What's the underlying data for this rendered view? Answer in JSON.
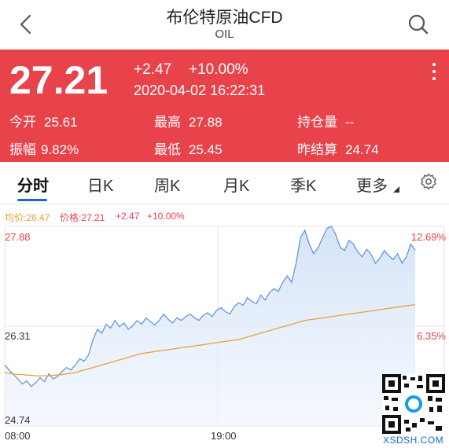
{
  "nav": {
    "title": "布伦特原油CFD",
    "subtitle": "OIL",
    "back_icon": "chevron-left-icon",
    "search_icon": "search-icon"
  },
  "quote": {
    "price": "27.21",
    "change": "+2.47",
    "change_pct": "+10.00%",
    "time": "2020-04-02 16:22:31",
    "color": "#e8434b",
    "stats": [
      {
        "label": "今开",
        "value": "25.61"
      },
      {
        "label": "最高",
        "value": "27.88"
      },
      {
        "label": "持仓量",
        "value": "--"
      },
      {
        "label": "振幅",
        "value": "9.82%"
      },
      {
        "label": "最低",
        "value": "25.45"
      },
      {
        "label": "昨结算",
        "value": "24.74"
      }
    ]
  },
  "tabs": [
    {
      "label": "分时",
      "active": true
    },
    {
      "label": "日K"
    },
    {
      "label": "周K"
    },
    {
      "label": "月K"
    },
    {
      "label": "季K"
    },
    {
      "label": "更多"
    }
  ],
  "accent": "#1a67d8",
  "info": {
    "avg_label": "均价:26.47",
    "price_label": "价格:27.21",
    "change": "+2.47",
    "change_pct": "+10.00%",
    "avg_color": "#e8a13a"
  },
  "chart_data": {
    "type": "line",
    "x_ticks": [
      "08:00",
      "19:00"
    ],
    "y_left": [
      "27.88",
      "26.31",
      "24.74"
    ],
    "y_right": [
      "12.69%",
      "6.35%"
    ],
    "ylim": [
      24.74,
      27.88
    ],
    "series": [
      {
        "name": "价格",
        "color": "#5b8fd8",
        "values": [
          25.7,
          25.62,
          25.55,
          25.48,
          25.4,
          25.45,
          25.36,
          25.42,
          25.5,
          25.44,
          25.56,
          25.48,
          25.52,
          25.6,
          25.66,
          25.62,
          25.7,
          25.8,
          25.76,
          25.86,
          26.1,
          26.26,
          26.2,
          26.34,
          26.28,
          26.4,
          26.3,
          26.36,
          26.26,
          26.32,
          26.4,
          26.34,
          26.44,
          26.38,
          26.33,
          26.4,
          26.5,
          26.42,
          26.36,
          26.44,
          26.4,
          26.46,
          26.5,
          26.44,
          26.4,
          26.48,
          26.52,
          26.46,
          26.56,
          26.6,
          26.54,
          26.5,
          26.62,
          26.68,
          26.64,
          26.76,
          26.7,
          26.66,
          26.8,
          26.72,
          26.84,
          26.9,
          26.86,
          27.0,
          27.1,
          27.0,
          27.3,
          27.7,
          27.82,
          27.6,
          27.45,
          27.55,
          27.7,
          27.85,
          27.88,
          27.75,
          27.55,
          27.5,
          27.66,
          27.6,
          27.48,
          27.4,
          27.52,
          27.44,
          27.3,
          27.38,
          27.5,
          27.42,
          27.36,
          27.45,
          27.3,
          27.4,
          27.6,
          27.5
        ]
      },
      {
        "name": "均价",
        "color": "#e8a13a",
        "values": [
          25.58,
          25.57,
          25.56,
          25.55,
          25.55,
          25.54,
          25.54,
          25.53,
          25.53,
          25.53,
          25.53,
          25.54,
          25.54,
          25.55,
          25.56,
          25.57,
          25.58,
          25.6,
          25.62,
          25.64,
          25.66,
          25.68,
          25.7,
          25.72,
          25.74,
          25.76,
          25.78,
          25.8,
          25.82,
          25.84,
          25.86,
          25.88,
          25.89,
          25.9,
          25.91,
          25.92,
          25.93,
          25.94,
          25.95,
          25.96,
          25.97,
          25.98,
          25.99,
          26.0,
          26.01,
          26.02,
          26.03,
          26.04,
          26.05,
          26.06,
          26.07,
          26.08,
          26.09,
          26.1,
          26.12,
          26.14,
          26.16,
          26.18,
          26.2,
          26.22,
          26.24,
          26.26,
          26.28,
          26.3,
          26.32,
          26.34,
          26.36,
          26.38,
          26.4,
          26.41,
          26.42,
          26.43,
          26.44,
          26.45,
          26.46,
          26.47,
          26.48,
          26.49,
          26.5,
          26.51,
          26.52,
          26.53,
          26.54,
          26.55,
          26.56,
          26.57,
          26.58,
          26.59,
          26.6,
          26.61,
          26.62,
          26.63,
          26.64,
          26.65
        ]
      }
    ],
    "grid": true
  },
  "watermark": {
    "caption": "XSDSH.COM"
  }
}
